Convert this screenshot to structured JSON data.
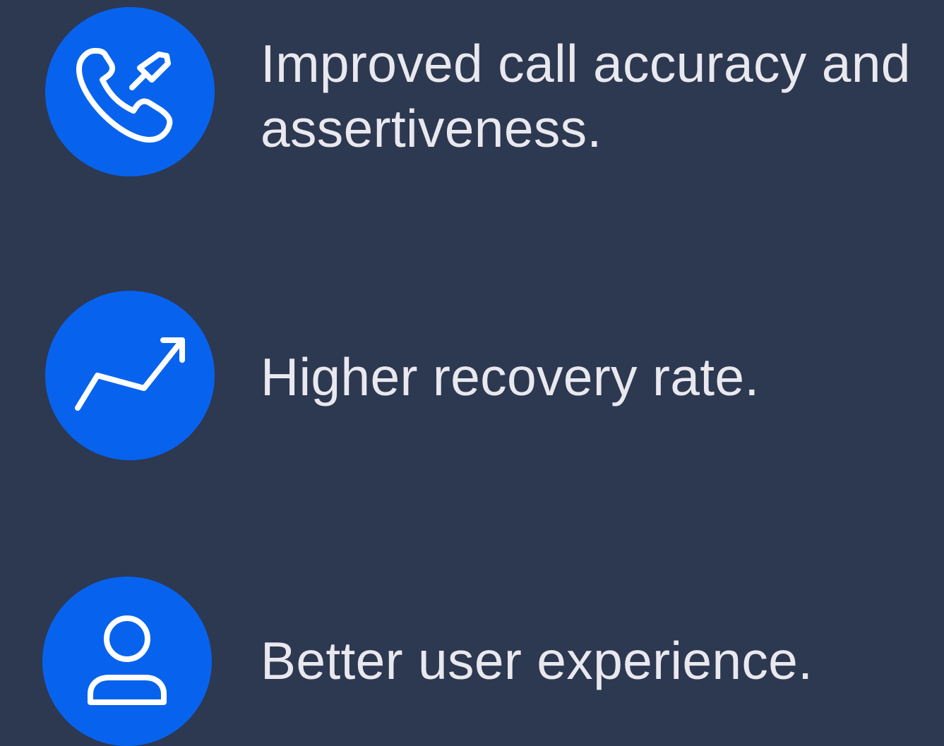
{
  "colors": {
    "background": "#2d3851",
    "icon_circle": "#0763ee",
    "text": "#e8e8ee"
  },
  "features": [
    {
      "icon": "phone-outgoing-icon",
      "line1": "Improved call accuracy and",
      "line2": "assertiveness."
    },
    {
      "icon": "trending-up-icon",
      "line1": "Higher recovery rate."
    },
    {
      "icon": "user-icon",
      "line1": "Better user experience."
    }
  ]
}
